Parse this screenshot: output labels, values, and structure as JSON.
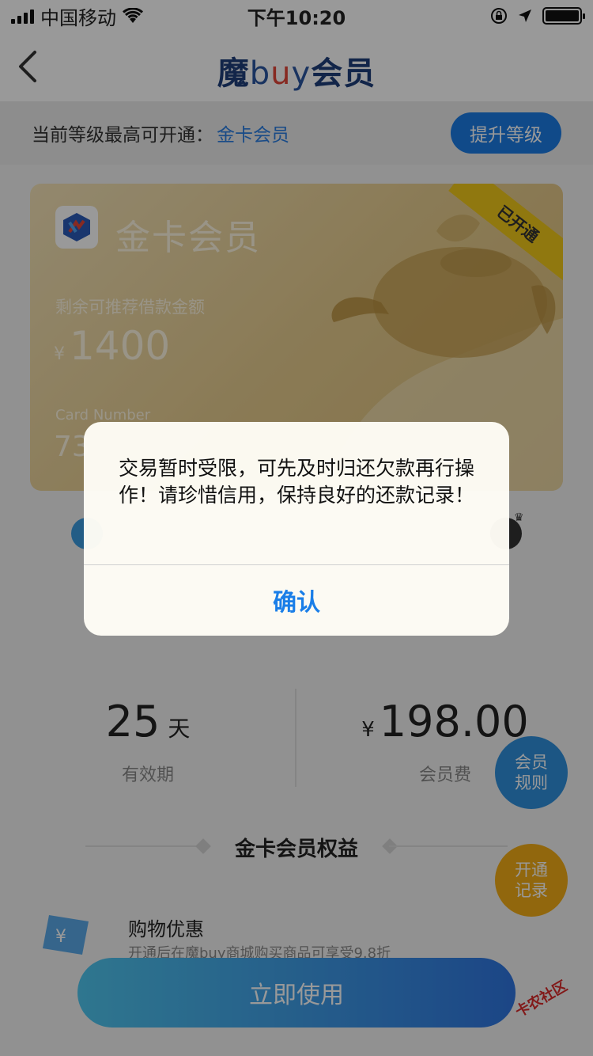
{
  "status_bar": {
    "carrier": "中国移动",
    "time": "下午10:20"
  },
  "nav": {
    "logo_cn": "魔",
    "logo_b": "b",
    "logo_u": "u",
    "logo_y": "y",
    "logo_tail": "会员"
  },
  "level_bar": {
    "label": "当前等级最高可开通：",
    "level": "金卡会员",
    "upgrade_label": "提升等级"
  },
  "card": {
    "title": "金卡会员",
    "ribbon": "已开通",
    "amount_label": "剩余可推荐借款金额",
    "currency": "¥",
    "amount": "1400",
    "number_label": "Card Number",
    "number_partial": "73"
  },
  "info": {
    "days": "25",
    "days_unit": "天",
    "days_label": "有效期",
    "currency": "¥",
    "fee": "198.00",
    "fee_label": "会员费"
  },
  "benefits": {
    "title": "金卡会员权益",
    "item_name": "购物优惠",
    "item_desc": "开通后在魔buy商城购买商品可享受9.8折"
  },
  "float_buttons": {
    "rules_line1": "会员",
    "rules_line2": "规则",
    "record_line1": "开通",
    "record_line2": "记录"
  },
  "use_button": "立即使用",
  "watermark": "卡农社区",
  "dialog": {
    "message": "交易暂时受限，可先及时归还欠款再行操作！请珍惜信用，保持良好的还款记录！",
    "confirm": "确认"
  },
  "colors": {
    "primary": "#1c7ce5",
    "gold_card": "#e7cd8f",
    "ribbon": "#f1c81a",
    "rules_btn": "#2f8fdc",
    "record_btn": "#f2ac16"
  }
}
